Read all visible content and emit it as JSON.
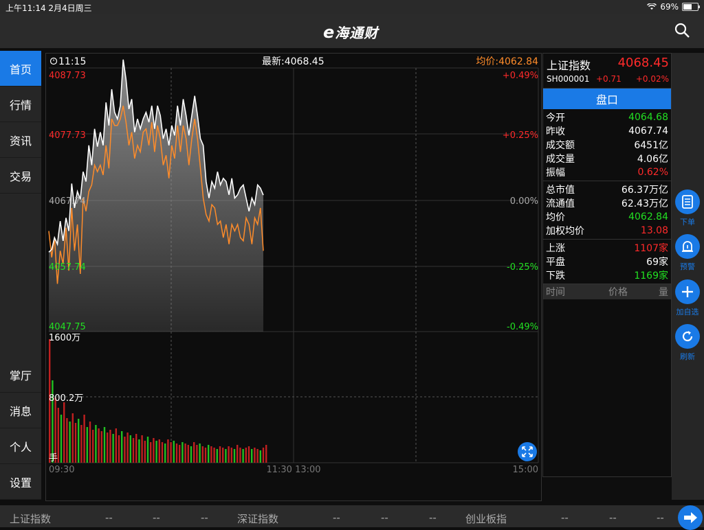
{
  "status": {
    "time_date": "上午11:14   2月4日周三",
    "battery": "69%",
    "battery_level": 0.69
  },
  "app": {
    "logo_e": "e",
    "logo_text": "海通财"
  },
  "sidebar": {
    "top_items": [
      {
        "label": "首页",
        "active": true
      },
      {
        "label": "行情"
      },
      {
        "label": "资讯"
      },
      {
        "label": "交易"
      }
    ],
    "bottom_items": [
      {
        "label": "掌厅"
      },
      {
        "label": "消息"
      },
      {
        "label": "个人"
      },
      {
        "label": "设置"
      }
    ]
  },
  "chart": {
    "time": "11:15",
    "latest": "最新:4068.45",
    "avg": "均价:4062.84",
    "price_labels": [
      "4087.73",
      "4077.73",
      "4067.74",
      "4057.74",
      "4047.75"
    ],
    "pct_labels": [
      "+0.49%",
      "+0.25%",
      "0.00%",
      "-0.25%",
      "-0.49%"
    ],
    "vol_labels": [
      "1600万",
      "800.2万"
    ],
    "vol_unit": "手",
    "time_labels": [
      "09:30",
      "11:30 13:00",
      "15:00"
    ]
  },
  "chart_data": {
    "type": "line",
    "series": [
      {
        "color": "#ffffff",
        "values": [
          4059.8,
          4060.2,
          4062.0,
          4061.0,
          4064.5,
          4061.5,
          4065.0,
          4063.0,
          4070.2,
          4066.5,
          4069.0,
          4067.8,
          4072.0,
          4070.5,
          4076.0,
          4073.0,
          4078.5,
          4075.8,
          4078.0,
          4076.0,
          4082.5,
          4079.0,
          4084.5,
          4081.0,
          4080.0,
          4082.0,
          4089.0,
          4086.0,
          4081.5,
          4083.0,
          4078.0,
          4080.0,
          4078.5,
          4080.0,
          4081.0,
          4079.5,
          4082.0,
          4078.5,
          4082.0,
          4080.5,
          4077.0,
          4078.5,
          4076.0,
          4079.0,
          4077.5,
          4082.0,
          4079.0,
          4083.0,
          4080.5,
          4077.5,
          4080.5,
          4083.5,
          4080.5,
          4077.0,
          4076.0,
          4070.5,
          4068.0,
          4070.5,
          4069.5,
          4072.0,
          4070.0,
          4071.0,
          4070.5,
          4068.5,
          4071.0,
          4068.0,
          4068.5,
          4069.5,
          4070.0,
          4068.0,
          4066.0,
          4068.0,
          4067.0,
          4070.0,
          4069.5,
          4068.45
        ]
      },
      {
        "color": "#ff8c2a",
        "values": [
          4063.0,
          4059.0,
          4062.0,
          4055.0,
          4060.0,
          4058.0,
          4063.5,
          4057.0,
          4066.5,
          4060.0,
          4064.0,
          4056.5,
          4068.0,
          4066.0,
          4069.0,
          4070.0,
          4073.0,
          4072.0,
          4073.0,
          4071.5,
          4076.0,
          4072.5,
          4080.0,
          4079.0,
          4079.0,
          4080.0,
          4082.0,
          4079.5,
          4076.0,
          4078.0,
          4074.0,
          4076.0,
          4075.0,
          4078.0,
          4078.5,
          4076.0,
          4079.5,
          4075.0,
          4079.0,
          4077.0,
          4073.0,
          4074.5,
          4071.0,
          4076.0,
          4074.0,
          4079.0,
          4075.0,
          4079.0,
          4077.0,
          4073.0,
          4077.0,
          4080.0,
          4077.0,
          4072.5,
          4068.0,
          4065.5,
          4064.5,
          4067.0,
          4066.5,
          4064.0,
          4064.5,
          4062.0,
          4064.0,
          4061.0,
          4064.0,
          4063.0,
          4064.0,
          4062.0,
          4061.5,
          4065.0,
          4064.0,
          4061.0,
          4065.0,
          4064.0,
          4066.5,
          4060.0
        ]
      }
    ],
    "ylim": [
      4047.75,
      4087.73
    ]
  },
  "info": {
    "name": "上证指数",
    "price": "4068.45",
    "code": "SH000001",
    "change": "+0.71",
    "pct": "+0.02%",
    "pankou": "盘口",
    "g1": [
      {
        "k": "今开",
        "v": "4064.68",
        "c": "green"
      },
      {
        "k": "昨收",
        "v": "4067.74",
        "c": ""
      },
      {
        "k": "成交额",
        "v": "6451亿",
        "c": ""
      },
      {
        "k": "成交量",
        "v": "4.06亿",
        "c": ""
      },
      {
        "k": "振幅",
        "v": "0.62%",
        "c": "red"
      }
    ],
    "g2": [
      {
        "k": "总市值",
        "v": "66.37万亿",
        "c": ""
      },
      {
        "k": "流通值",
        "v": "62.43万亿",
        "c": ""
      },
      {
        "k": "均价",
        "v": "4062.84",
        "c": "green"
      },
      {
        "k": "加权均价",
        "v": "13.08",
        "c": "red"
      }
    ],
    "g3": [
      {
        "k": "上涨",
        "v": "1107家",
        "c": "red"
      },
      {
        "k": "平盘",
        "v": "69家",
        "c": ""
      },
      {
        "k": "下跌",
        "v": "1169家",
        "c": "green"
      }
    ],
    "table_head": {
      "time": "时间",
      "price": "价格",
      "vol": "量"
    }
  },
  "rightbar": [
    {
      "label": "下单"
    },
    {
      "label": "预警"
    },
    {
      "label": "加自选"
    },
    {
      "label": "刷新"
    }
  ],
  "ticker": {
    "items": [
      {
        "name": "上证指数",
        "a": "--",
        "b": "--",
        "c": "--"
      },
      {
        "name": "深证指数",
        "a": "--",
        "b": "--",
        "c": "--"
      },
      {
        "name": "创业板指",
        "a": "--",
        "b": "--",
        "c": "--"
      }
    ]
  }
}
